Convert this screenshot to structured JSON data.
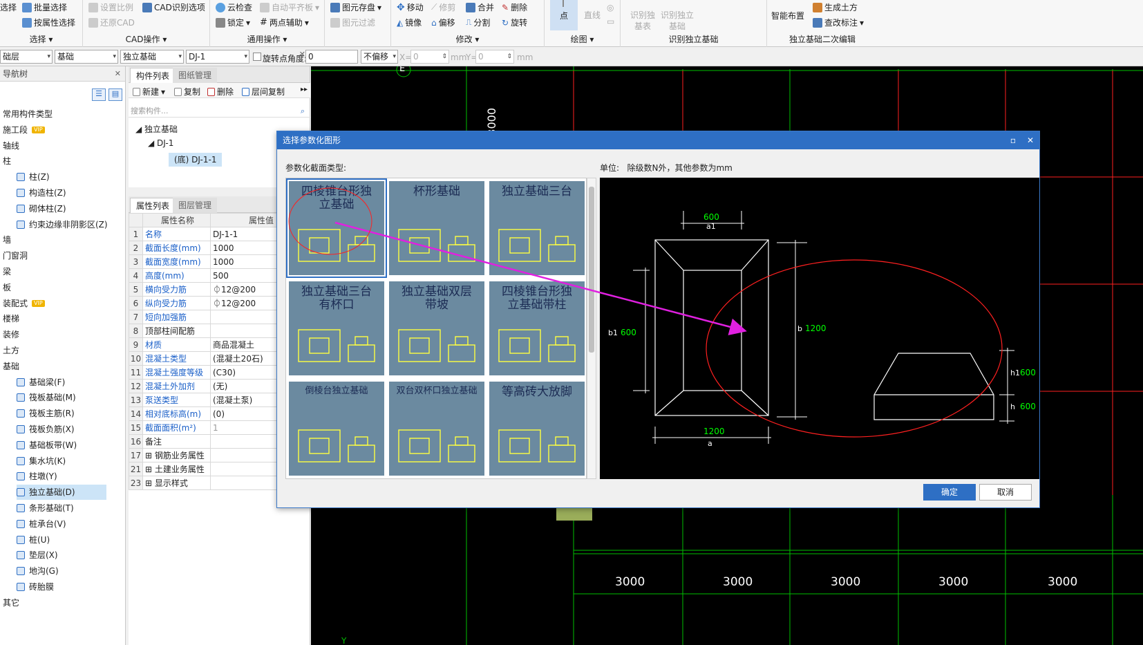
{
  "ribbon": {
    "select_group": {
      "items": [
        "选择",
        "批量选择",
        "按属性选择"
      ],
      "title": "选择"
    },
    "cad_group": {
      "items": [
        "设置比例",
        "CAD识别选项",
        "还原CAD"
      ],
      "title": "CAD操作"
    },
    "common_group": {
      "items": [
        "云检查",
        "自动平齐板",
        "锁定",
        "两点辅助"
      ],
      "title": "通用操作"
    },
    "pic_group": {
      "items": [
        "图元存盘",
        "图元过滤"
      ]
    },
    "modify_group": {
      "items": [
        "移动",
        "修剪",
        "合并",
        "删除",
        "镜像",
        "偏移",
        "分割",
        "旋转"
      ],
      "title": "修改"
    },
    "draw_group": {
      "items": [
        "点",
        "直线"
      ],
      "title": "绘图"
    },
    "ident_group": {
      "items": [
        "识别独基表",
        "识别独立基础"
      ],
      "title": "识别独立基础"
    },
    "second_group": {
      "items": [
        "智能布置",
        "生成土方",
        "查改标注"
      ],
      "title": "独立基础二次编辑"
    }
  },
  "toolbar": {
    "floor": "础层",
    "category": "基础",
    "type": "独立基础",
    "component": "DJ-1",
    "rotate_label": "旋转点",
    "angle_label": "角度:",
    "angle_value": "0",
    "offset": "不偏移",
    "x_label": "X=",
    "x_value": "0",
    "unit1": "mm",
    "y_label": "Y=",
    "y_value": "0",
    "unit2": "mm"
  },
  "nav": {
    "title": "导航树",
    "items": [
      {
        "label": "常用构件类型",
        "sub": false
      },
      {
        "label": "施工段",
        "sub": false,
        "vip": "VIP"
      },
      {
        "label": "轴线",
        "sub": false
      },
      {
        "label": "柱",
        "sub": false
      },
      {
        "label": "柱(Z)",
        "sub": true
      },
      {
        "label": "构造柱(Z)",
        "sub": true
      },
      {
        "label": "砌体柱(Z)",
        "sub": true
      },
      {
        "label": "约束边缘非阴影区(Z)",
        "sub": true
      },
      {
        "label": "墙",
        "sub": false
      },
      {
        "label": "门窗洞",
        "sub": false
      },
      {
        "label": "梁",
        "sub": false
      },
      {
        "label": "板",
        "sub": false
      },
      {
        "label": "装配式",
        "sub": false,
        "vip": "VIP"
      },
      {
        "label": "楼梯",
        "sub": false
      },
      {
        "label": "装修",
        "sub": false
      },
      {
        "label": "土方",
        "sub": false
      },
      {
        "label": "基础",
        "sub": false
      },
      {
        "label": "基础梁(F)",
        "sub": true
      },
      {
        "label": "筏板基础(M)",
        "sub": true
      },
      {
        "label": "筏板主筋(R)",
        "sub": true
      },
      {
        "label": "筏板负筋(X)",
        "sub": true
      },
      {
        "label": "基础板带(W)",
        "sub": true
      },
      {
        "label": "集水坑(K)",
        "sub": true
      },
      {
        "label": "柱墩(Y)",
        "sub": true
      },
      {
        "label": "独立基础(D)",
        "sub": true,
        "active": true
      },
      {
        "label": "条形基础(T)",
        "sub": true
      },
      {
        "label": "桩承台(V)",
        "sub": true
      },
      {
        "label": "桩(U)",
        "sub": true
      },
      {
        "label": "垫层(X)",
        "sub": true
      },
      {
        "label": "地沟(G)",
        "sub": true
      },
      {
        "label": "砖胎膜",
        "sub": true
      },
      {
        "label": "其它",
        "sub": false
      }
    ]
  },
  "comp_panel": {
    "tab1": "构件列表",
    "tab2": "图纸管理",
    "new": "新建",
    "copy": "复制",
    "delete": "删除",
    "floor_copy": "层间复制",
    "search_placeholder": "搜索构件...",
    "tree": [
      "独立基础",
      "DJ-1",
      "(底) DJ-1-1"
    ]
  },
  "props_panel": {
    "tab1": "属性列表",
    "tab2": "图层管理",
    "col_name": "属性名称",
    "col_value": "属性值",
    "rows": [
      {
        "n": "1",
        "name": "名称",
        "value": "DJ-1-1",
        "blue": true
      },
      {
        "n": "2",
        "name": "截面长度(mm)",
        "value": "1000",
        "blue": true
      },
      {
        "n": "3",
        "name": "截面宽度(mm)",
        "value": "1000",
        "blue": true
      },
      {
        "n": "4",
        "name": "高度(mm)",
        "value": "500",
        "blue": true
      },
      {
        "n": "5",
        "name": "横向受力筋",
        "value": "⏀12@200",
        "blue": true
      },
      {
        "n": "6",
        "name": "纵向受力筋",
        "value": "⏀12@200",
        "blue": true
      },
      {
        "n": "7",
        "name": "短向加强筋",
        "value": "",
        "blue": true
      },
      {
        "n": "8",
        "name": "顶部柱间配筋",
        "value": "",
        "blue": false
      },
      {
        "n": "9",
        "name": "材质",
        "value": "商品混凝土",
        "blue": true
      },
      {
        "n": "10",
        "name": "混凝土类型",
        "value": "(混凝土20石)",
        "blue": true
      },
      {
        "n": "11",
        "name": "混凝土强度等级",
        "value": "(C30)",
        "blue": true
      },
      {
        "n": "12",
        "name": "混凝土外加剂",
        "value": "(无)",
        "blue": true
      },
      {
        "n": "13",
        "name": "泵送类型",
        "value": "(混凝土泵)",
        "blue": true
      },
      {
        "n": "14",
        "name": "相对底标高(m)",
        "value": "(0)",
        "blue": true
      },
      {
        "n": "15",
        "name": "截面面积(m²)",
        "value": "1",
        "blue": true,
        "gray": true
      },
      {
        "n": "16",
        "name": "备注",
        "value": "",
        "blue": false
      },
      {
        "n": "17",
        "name": "钢筋业务属性",
        "value": "",
        "blue": false,
        "expand": true
      },
      {
        "n": "21",
        "name": "土建业务属性",
        "value": "",
        "blue": false,
        "expand": true
      },
      {
        "n": "23",
        "name": "显示样式",
        "value": "",
        "blue": false,
        "expand": true
      }
    ]
  },
  "canvas": {
    "axis_label_e": "E",
    "axis_label_y": "Y",
    "dim_vert": "3000",
    "dims": [
      "3000",
      "3000",
      "3000",
      "3000",
      "3000"
    ]
  },
  "dialog": {
    "title": "选择参数化图形",
    "section_label": "参数化截面类型:",
    "unit_label": "单位:",
    "unit_note": "除级数N外，其他参数为mm",
    "ok": "确定",
    "cancel": "取消",
    "thumbs": [
      {
        "title": "四棱锥台形独立基础",
        "small": false
      },
      {
        "title": "杯形基础",
        "small": false
      },
      {
        "title": "独立基础三台",
        "small": false
      },
      {
        "title": "独立基础三台有杯口",
        "small": false
      },
      {
        "title": "独立基础双层带坡",
        "small": false
      },
      {
        "title": "四棱锥台形独立基础带柱",
        "small": false
      },
      {
        "title": "倒棱台独立基础",
        "small": true
      },
      {
        "title": "双台双杯口独立基础",
        "small": true
      },
      {
        "title": "等高砖大放脚",
        "small": false
      }
    ],
    "preview": {
      "a_top": "600",
      "a1_label": "a1",
      "b_label": "b",
      "b_value": "1200",
      "b1_label": "b1",
      "b1_value": "600",
      "a_bottom": "1200",
      "a_label": "a",
      "h1_label": "h1",
      "h1_value": "600",
      "h_label": "h",
      "h_value": "600"
    }
  },
  "colors": {
    "accent": "#2e6fc4",
    "cad_green": "#00ff00",
    "cad_red": "#ff2020",
    "magenta": "#e020e0",
    "thumb_bg": "#6b8aa0",
    "thumb_yellow": "#ffff40"
  }
}
